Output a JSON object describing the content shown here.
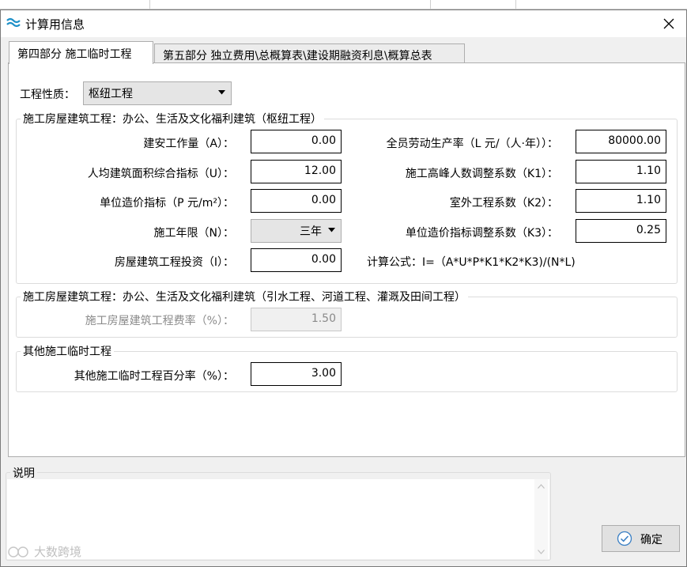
{
  "window": {
    "title": "计算用信息"
  },
  "tabs": [
    {
      "label": "第四部分 施工临时工程",
      "active": true
    },
    {
      "label": "第五部分 独立费用\\总概算表\\建设期融资利息\\概算总表",
      "active": false
    }
  ],
  "project_type": {
    "label": "工程性质：",
    "value": "枢纽工程"
  },
  "group1": {
    "title": "施工房屋建筑工程：办公、生活及文化福利建筑（枢纽工程）",
    "A": {
      "label": "建安工作量（A）：",
      "value": "0.00"
    },
    "U": {
      "label": "人均建筑面积综合指标（U）：",
      "value": "12.00"
    },
    "P": {
      "label": "单位造价指标（P 元/m²）：",
      "value": "0.00"
    },
    "N": {
      "label": "施工年限（N）：",
      "value": "三年"
    },
    "I": {
      "label": "房屋建筑工程投资（I）：",
      "value": "0.00"
    },
    "L": {
      "label": "全员劳动生产率（L 元/（人·年））：",
      "value": "80000.00"
    },
    "K1": {
      "label": "施工高峰人数调整系数（K1）：",
      "value": "1.10"
    },
    "K2": {
      "label": "室外工程系数（K2）：",
      "value": "1.10"
    },
    "K3": {
      "label": "单位造价指标调整系数（K3）：",
      "value": "0.25"
    },
    "formula": "计算公式：I=（A*U*P*K1*K2*K3)/(N*L)"
  },
  "group2": {
    "title": "施工房屋建筑工程：办公、生活及文化福利建筑（引水工程、河道工程、灌溉及田间工程）",
    "rate": {
      "label": "施工房屋建筑工程费率（%）：",
      "value": "1.50"
    }
  },
  "group3": {
    "title": "其他施工临时工程",
    "rate": {
      "label": "其他施工临时工程百分率（%）：",
      "value": "3.00"
    }
  },
  "description": {
    "title": "说明"
  },
  "ok_button": {
    "label": "确定"
  },
  "watermark": "大数跨境",
  "colors": {
    "accent": "#1e90c8",
    "field_border": "#000000",
    "disabled_text": "#8a8a8a"
  }
}
